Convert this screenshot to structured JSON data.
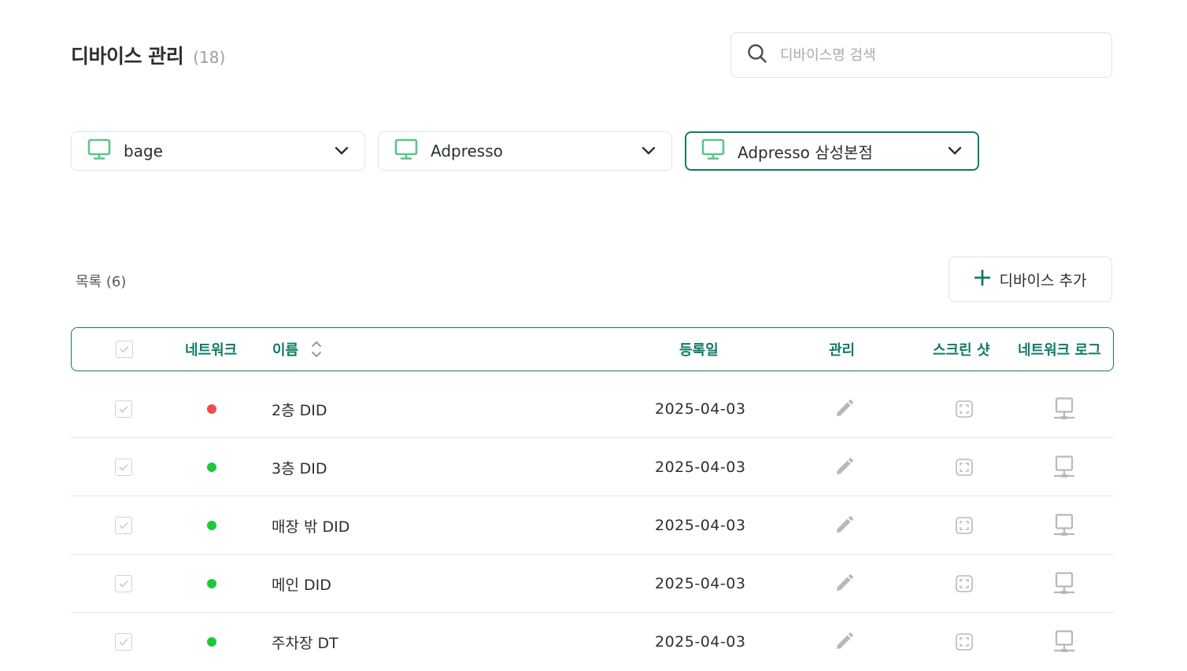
{
  "header": {
    "title": "디바이스 관리",
    "count": "(18)"
  },
  "search": {
    "placeholder": "디바이스명 검색",
    "value": ""
  },
  "filters": [
    {
      "label": "bage",
      "icon": "monitor-icon"
    },
    {
      "label": "Adpresso",
      "icon": "monitor-icon"
    },
    {
      "label": "Adpresso 삼성본점",
      "icon": "monitor-icon",
      "active": true
    }
  ],
  "list": {
    "count_label": "목록 (6)",
    "add_button": "디바이스 추가"
  },
  "table": {
    "columns": {
      "network": "네트워크",
      "name": "이름",
      "registered": "등록일",
      "manage": "관리",
      "screenshot": "스크린 샷",
      "network_log": "네트워크 로그"
    },
    "rows": [
      {
        "name": "2층 DID",
        "date": "2025-04-03",
        "status": "offline"
      },
      {
        "name": "3층 DID",
        "date": "2025-04-03",
        "status": "online"
      },
      {
        "name": "매장 밖 DID",
        "date": "2025-04-03",
        "status": "online"
      },
      {
        "name": "메인 DID",
        "date": "2025-04-03",
        "status": "online"
      },
      {
        "name": "주차장 DT",
        "date": "2025-04-03",
        "status": "online"
      }
    ]
  },
  "colors": {
    "accent": "#0f7b65",
    "monitor_icon": "#5cc48a",
    "online": "#1ec83c",
    "offline": "#ee4b4b",
    "muted_icon": "#b5b9bd"
  }
}
